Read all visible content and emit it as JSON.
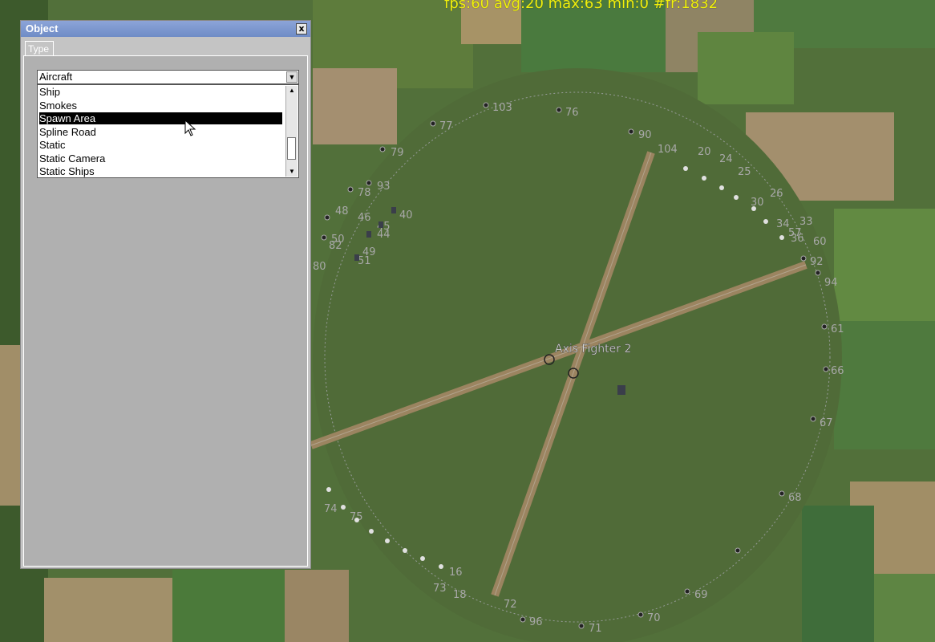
{
  "hud": {
    "fps_text": "fps:60 avg:20 max:63 min:0 #fr:1832"
  },
  "dialog": {
    "title": "Object",
    "close_label": "x",
    "tab": "Type",
    "type_combo": {
      "selected": "Aircraft",
      "options": [
        "Ship",
        "Smokes",
        "Spawn Area",
        "Spline Road",
        "Static",
        "Static Camera",
        "Static Ships"
      ],
      "highlighted": "Spawn Area"
    }
  },
  "map": {
    "center_label": "Axis Fighter 2",
    "node_numbers": [
      "103",
      "76",
      "77",
      "90",
      "79",
      "93",
      "78",
      "48",
      "50",
      "82",
      "49",
      "51",
      "80",
      "94",
      "61",
      "66",
      "67",
      "68",
      "69",
      "70",
      "71",
      "96",
      "72",
      "16",
      "18",
      "73",
      "75",
      "74",
      "92",
      "60",
      "33",
      "57",
      "34",
      "36",
      "40",
      "44",
      "45",
      "46"
    ]
  }
}
